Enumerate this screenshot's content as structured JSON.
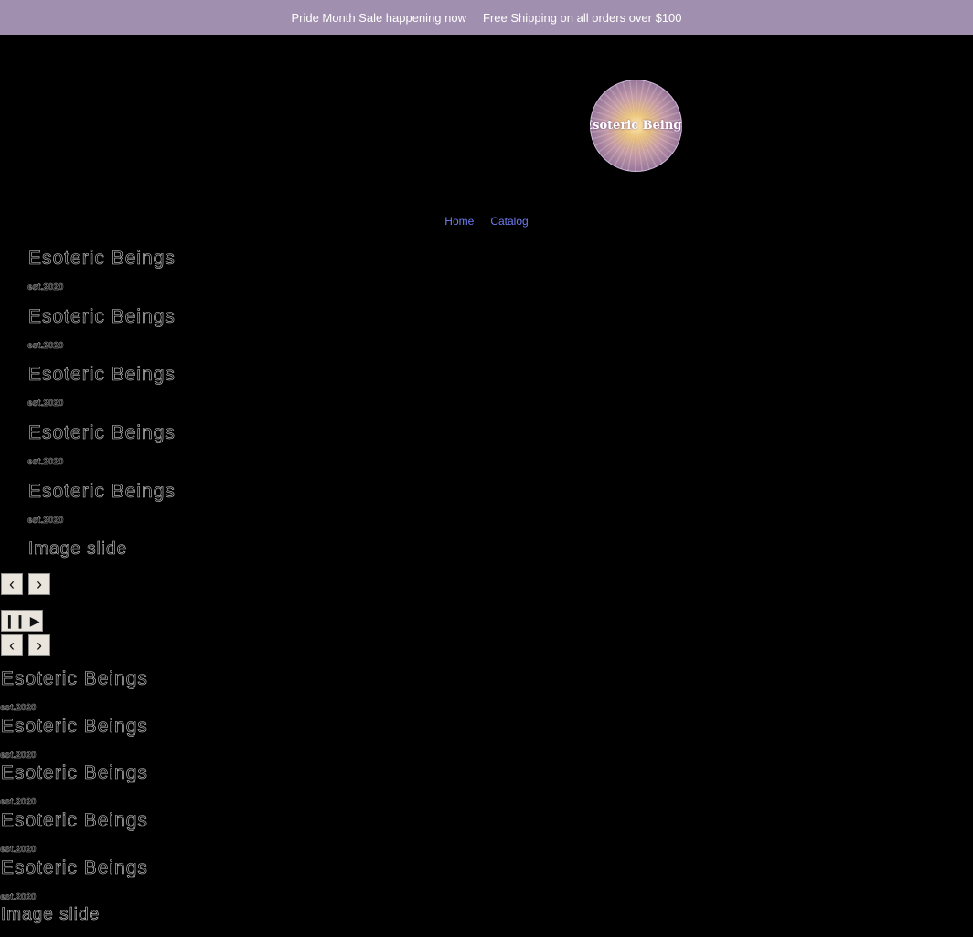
{
  "announcement": {
    "message_1": "Pride Month Sale happening now",
    "message_2": "Free Shipping on all orders over $100"
  },
  "logo": {
    "text": "Esoteric Beings"
  },
  "nav": {
    "items": [
      {
        "label": "Home"
      },
      {
        "label": "Catalog"
      }
    ]
  },
  "slideshow_1": {
    "slides": [
      {
        "title": "Esoteric Beings",
        "subtitle": "est.2020"
      },
      {
        "title": "Esoteric Beings",
        "subtitle": "est.2020"
      },
      {
        "title": "Esoteric Beings",
        "subtitle": "est.2020"
      },
      {
        "title": "Esoteric Beings",
        "subtitle": "est.2020"
      },
      {
        "title": "Esoteric Beings",
        "subtitle": "est.2020"
      }
    ],
    "heading": "Image slide"
  },
  "slideshow_2": {
    "slides": [
      {
        "title": "Esoteric Beings",
        "subtitle": "est.2020"
      },
      {
        "title": "Esoteric Beings",
        "subtitle": "est.2020"
      },
      {
        "title": "Esoteric Beings",
        "subtitle": "est.2020"
      },
      {
        "title": "Esoteric Beings",
        "subtitle": "est.2020"
      },
      {
        "title": "Esoteric Beings",
        "subtitle": "est.2020"
      }
    ],
    "heading": "Image slide"
  },
  "controls": {
    "prev_icon": "chevron-left-icon",
    "next_icon": "chevron-right-icon",
    "pause_icon": "pause-icon",
    "play_icon": "play-icon"
  },
  "colors": {
    "announcement_bg": "#a08fae",
    "page_bg": "#000000",
    "nav_link": "#6e7cf0"
  }
}
